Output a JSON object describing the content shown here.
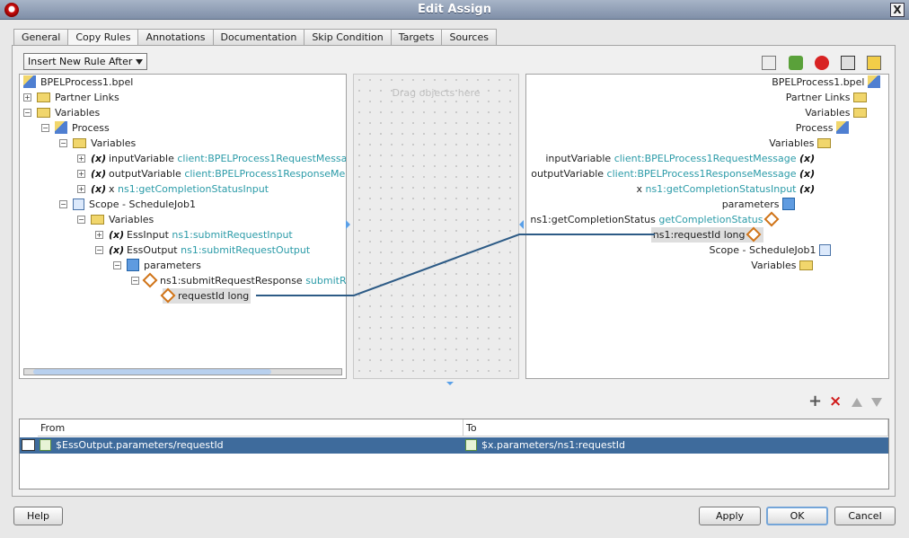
{
  "window": {
    "title": "Edit Assign",
    "close": "X"
  },
  "tabs": [
    "General",
    "Copy Rules",
    "Annotations",
    "Documentation",
    "Skip Condition",
    "Targets",
    "Sources"
  ],
  "toolbar": {
    "insert_rule": "Insert New Rule After"
  },
  "left_tree": [
    {
      "label": "BPEL",
      "suffix": "Process1.bpel",
      "type": ""
    },
    {
      "label": "Partner Links",
      "type": ""
    },
    {
      "label": "Variables",
      "type": ""
    },
    {
      "label": "Process",
      "type": ""
    },
    {
      "label": "Variables",
      "type": ""
    },
    {
      "label": "inputVariable ",
      "type": "client:BPELProcess1RequestMessag"
    },
    {
      "label": "outputVariable ",
      "type": "client:BPELProcess1ResponseMes"
    },
    {
      "label": "x ",
      "type": "ns1:getCompletionStatusInput"
    },
    {
      "label": "Scope - ScheduleJob1",
      "type": ""
    },
    {
      "label": "Variables",
      "type": ""
    },
    {
      "label": "EssInput ",
      "type": "ns1:submitRequestInput"
    },
    {
      "label": "EssOutput ",
      "type": "ns1:submitRequestOutput"
    },
    {
      "label": "parameters",
      "type": ""
    },
    {
      "label": "ns1:submitRequestResponse ",
      "type": "submitR"
    },
    {
      "label": "requestId long",
      "type": ""
    }
  ],
  "middle": {
    "hint": "Drag objects here"
  },
  "right_tree": [
    {
      "label": "BPELProcess1.bpel",
      "type": ""
    },
    {
      "label": "Partner Links",
      "type": ""
    },
    {
      "label": "Variables",
      "type": ""
    },
    {
      "label": "Process",
      "type": ""
    },
    {
      "label": "Variables",
      "type": ""
    },
    {
      "label": "inputVariable ",
      "type": "client:BPELProcess1RequestMessage"
    },
    {
      "label": "outputVariable ",
      "type": "client:BPELProcess1ResponseMessage"
    },
    {
      "label": "x ",
      "type": "ns1:getCompletionStatusInput"
    },
    {
      "label": "parameters",
      "type": ""
    },
    {
      "label": "ns1:getCompletionStatus ",
      "type": "getCompletionStatus"
    },
    {
      "label": "ns1:requestId long",
      "type": ""
    },
    {
      "label": "Scope - ScheduleJob1",
      "type": ""
    },
    {
      "label": "Variables",
      "type": ""
    }
  ],
  "table": {
    "from": "From",
    "to": "To",
    "row_from": "$EssOutput.parameters/requestId",
    "row_to": "$x.parameters/ns1:requestId"
  },
  "buttons": {
    "help": "Help",
    "apply": "Apply",
    "ok": "OK",
    "cancel": "Cancel"
  }
}
